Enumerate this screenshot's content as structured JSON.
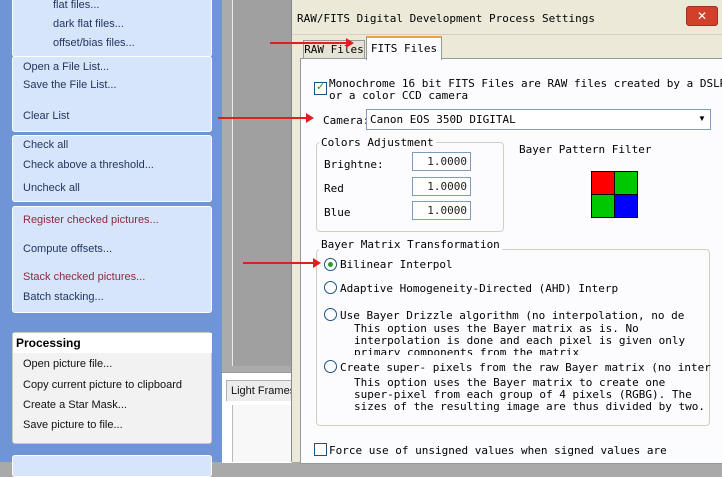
{
  "left_pane": {
    "group1": [
      "flat files...",
      "dark flat files...",
      "offset/bias files..."
    ],
    "group2": [
      "Open a File List...",
      "Save the File List...",
      "Clear List"
    ],
    "group3": [
      "Check all",
      "Check above a threshold...",
      "Uncheck all"
    ],
    "group4": [
      "Register checked pictures...",
      "Compute offsets...",
      "Stack checked pictures...",
      "Batch stacking..."
    ],
    "processing": {
      "title": "Processing",
      "items": [
        "Open picture file...",
        "Copy current picture to clipboard",
        "Create a Star Mask...",
        "Save picture to file..."
      ]
    }
  },
  "middle": {
    "light_frames_tab": "Light Frames"
  },
  "dialog": {
    "title": "RAW/FITS Digital Development Process Settings",
    "close_symbol": "✕",
    "tabs": [
      "RAW Files",
      "FITS Files"
    ],
    "monochrome_label_line1": "Monochrome 16 bit FITS Files are RAW files created by a DSLR",
    "monochrome_label_line2": "or a color CCD camera",
    "camera_label": "Camera:",
    "camera_value": "Canon EOS 350D DIGITAL",
    "dropdown_symbol": "▼",
    "colors": {
      "title": "Colors Adjustment",
      "rows": [
        {
          "label": "Brightne:",
          "value": "1.0000"
        },
        {
          "label": "Red",
          "value": "1.0000"
        },
        {
          "label": "Blue",
          "value": "1.0000"
        }
      ]
    },
    "bayer_filter_title": "Bayer Pattern Filter",
    "bayer_colors": [
      "#ff0000",
      "#00c800",
      "#00c800",
      "#0000ff"
    ],
    "bayer_transform": {
      "title": "Bayer Matrix Transformation",
      "options": [
        {
          "label": "Bilinear Interpol",
          "selected": true
        },
        {
          "label": "Adaptive Homogeneity-Directed (AHD) Interp",
          "selected": false
        },
        {
          "label": "Use Bayer Drizzle algorithm (no interpolation, no de",
          "selected": false
        },
        {
          "label": "Create super- pixels from the raw Bayer matrix (no inter",
          "selected": false
        }
      ],
      "drizzle_desc": [
        "This option uses the Bayer matrix as is. No",
        "interpolation is done and each pixel is given only",
        "primary components from the matrix"
      ],
      "superpixel_desc": [
        "This option uses the Bayer matrix to create one",
        "super-pixel from each group of 4 pixels (RGBG). The",
        "sizes of the resulting image are thus divided by two."
      ]
    },
    "force_unsigned_label": "Force use of unsigned values when signed values are"
  },
  "annotation_color": "#e02020"
}
